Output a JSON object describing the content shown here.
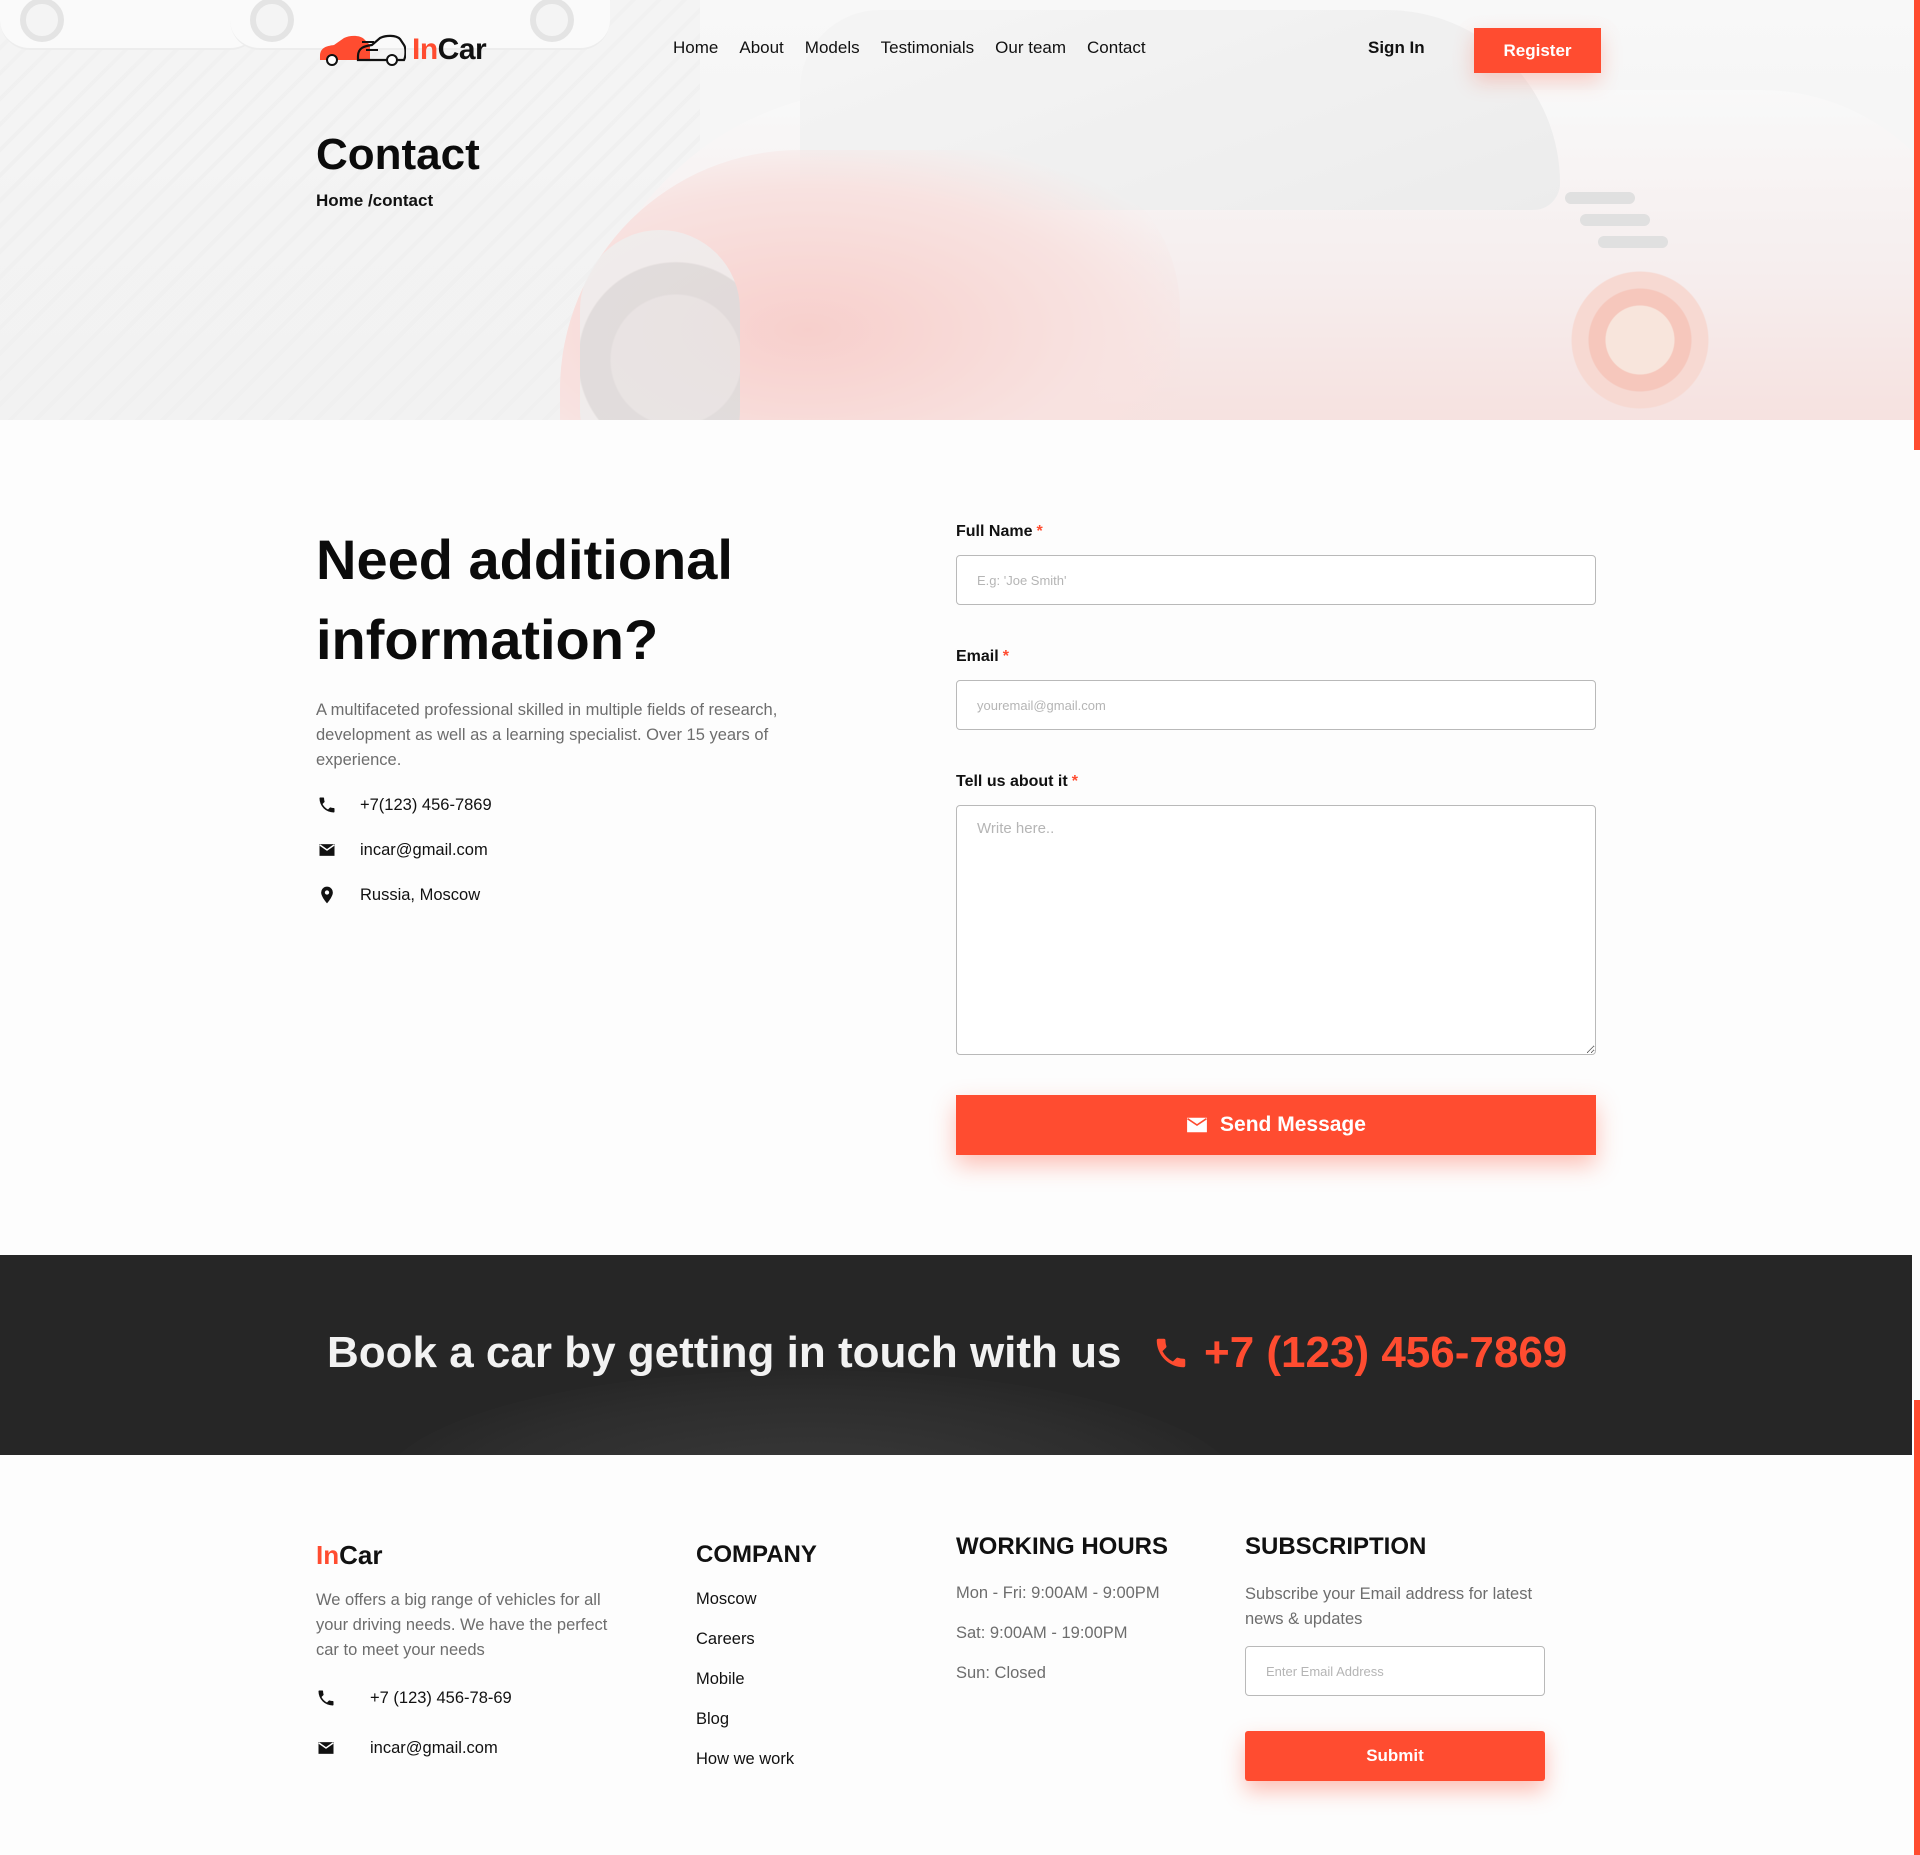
{
  "brand": {
    "prefix": "In",
    "suffix": "Car"
  },
  "nav": {
    "items": [
      "Home",
      "About",
      "Models",
      "Testimonials",
      "Our team",
      "Contact"
    ],
    "sign_in": "Sign In",
    "register": "Register"
  },
  "hero": {
    "title": "Contact",
    "breadcrumb": "Home /contact"
  },
  "contact": {
    "headline": "Need additional information?",
    "description": "A multifaceted professional skilled in multiple fields of research, development as well as a learning specialist. Over 15 years of experience.",
    "phone": "+7(123) 456-7869",
    "email": "incar@gmail.com",
    "location": "Russia, Moscow",
    "icons": [
      "phone-icon",
      "mail-icon",
      "location-pin-icon"
    ]
  },
  "form": {
    "name_label": "Full Name",
    "name_placeholder": "E.g: 'Joe Smith'",
    "email_label": "Email",
    "email_placeholder": "youremail@gmail.com",
    "message_label": "Tell us about it",
    "message_placeholder": "Write here..",
    "required_mark": "*",
    "submit": "Send Message"
  },
  "banner": {
    "text": "Book a car by getting in touch with us",
    "phone": "+7 (123) 456-7869"
  },
  "footer": {
    "description": "We offers a big range of vehicles for all your driving needs. We have the perfect car to meet your needs",
    "phone": "+7 (123) 456-78-69",
    "email": "incar@gmail.com",
    "company": {
      "title": "COMPANY",
      "links": [
        "Moscow",
        "Careers",
        "Mobile",
        "Blog",
        "How we work"
      ]
    },
    "hours": {
      "title": "WORKING HOURS",
      "lines": [
        "Mon - Fri: 9:00AM - 9:00PM",
        "Sat: 9:00AM - 19:00PM",
        "Sun: Closed"
      ]
    },
    "subscription": {
      "title": "SUBSCRIPTION",
      "description": "Subscribe your Email address for latest news & updates",
      "placeholder": "Enter Email Address",
      "submit": "Submit"
    }
  },
  "colors": {
    "accent": "#ff4c30",
    "dark": "#262626",
    "text": "#111111",
    "muted": "#6d6d6d"
  }
}
